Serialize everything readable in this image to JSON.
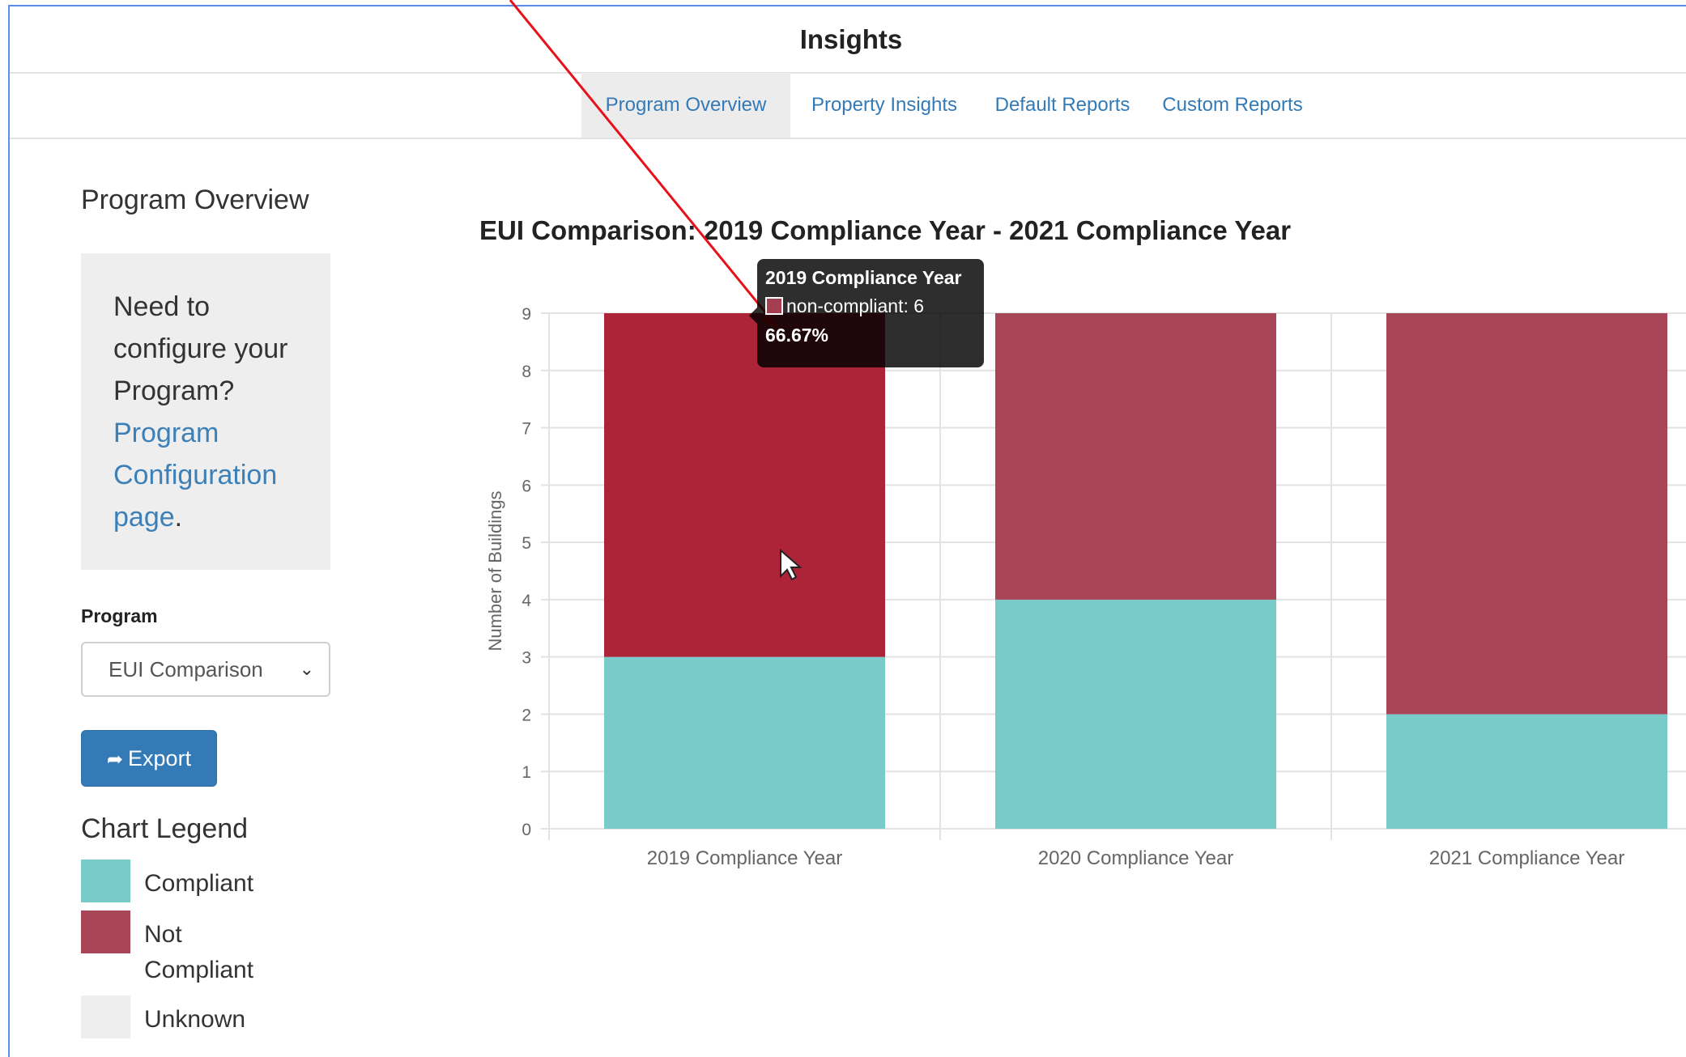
{
  "header": {
    "title": "Insights"
  },
  "tabs": [
    {
      "label": "Program Overview",
      "active": true
    },
    {
      "label": "Property Insights"
    },
    {
      "label": "Default Reports"
    },
    {
      "label": "Custom Reports"
    }
  ],
  "sidebar": {
    "title": "Program Overview",
    "callout": {
      "text": "Need to configure your Program?",
      "link": "Program Configuration page",
      "suffix": "."
    },
    "program_label": "Program",
    "program_select": "EUI Comparison",
    "export_label": "Export",
    "legend_title": "Chart Legend",
    "legend": [
      {
        "label": "Compliant",
        "color": "#79cbca"
      },
      {
        "label": "Not Compliant",
        "color": "#a84556"
      },
      {
        "label": "Unknown",
        "color": "#eeeeee"
      }
    ]
  },
  "chart_data": {
    "type": "bar",
    "stacked": true,
    "title": "EUI Comparison: 2019 Compliance Year - 2021 Compliance Year",
    "ylabel": "Number of Buildings",
    "xlabel": "",
    "ylim": [
      0,
      9
    ],
    "yticks": [
      0,
      1,
      2,
      3,
      4,
      5,
      6,
      7,
      8,
      9
    ],
    "categories": [
      "2019 Compliance Year",
      "2020 Compliance Year",
      "2021 Compliance Year"
    ],
    "series": [
      {
        "name": "compliant",
        "values": [
          3,
          4,
          2
        ],
        "color": "#79cbca"
      },
      {
        "name": "non-compliant",
        "values": [
          6,
          5,
          7
        ],
        "color": "#a84556",
        "highlight_color": "#ad2439"
      }
    ],
    "highlighted": {
      "category": 0,
      "series": 1
    },
    "grid": true
  },
  "tooltip": {
    "title": "2019 Compliance Year",
    "row": "non-compliant: 6",
    "percent": "66.67%"
  }
}
